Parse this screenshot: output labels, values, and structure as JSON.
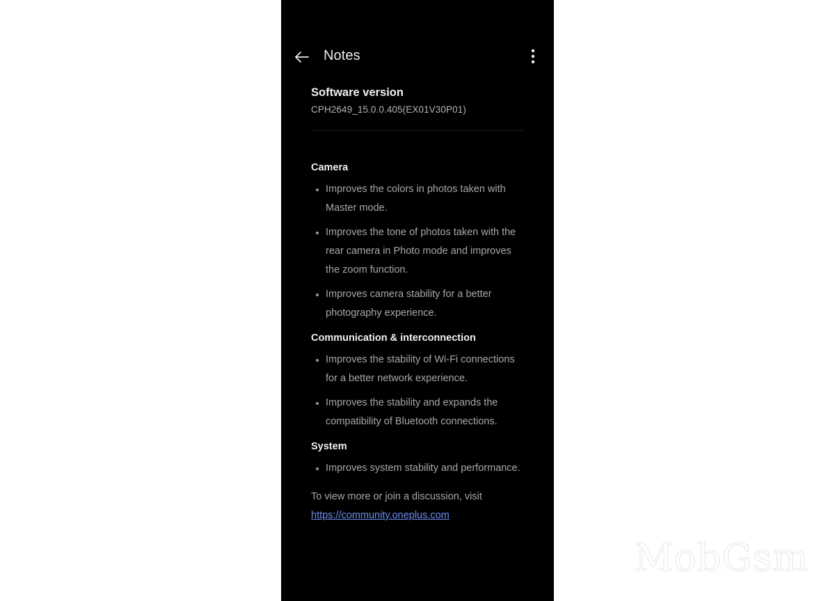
{
  "app_bar": {
    "back_icon": "arrow-left-icon",
    "title": "Notes",
    "more_icon": "more-vertical-icon"
  },
  "software": {
    "heading": "Software version",
    "version": "CPH2649_15.0.0.405(EX01V30P01)"
  },
  "sections": [
    {
      "title": "Camera",
      "items": [
        "Improves the colors in photos taken with Master mode.",
        "Improves the tone of photos taken with the rear camera in Photo mode and improves the zoom function.",
        "Improves camera stability for a better photography experience."
      ]
    },
    {
      "title": "Communication & interconnection",
      "items": [
        "Improves the stability of Wi-Fi connections for a better network experience.",
        "Improves the stability and expands the compatibility of Bluetooth connections."
      ]
    },
    {
      "title": "System",
      "items": [
        "Improves system stability and performance."
      ]
    }
  ],
  "footer": {
    "text": "To view more or join a discussion, visit",
    "link": "https://community.oneplus.com"
  },
  "watermark": "MobGsm",
  "colors": {
    "background": "#000000",
    "link": "#6b8ef0",
    "body_text": "#a8a8a8",
    "heading_text": "#f0f0f0"
  }
}
